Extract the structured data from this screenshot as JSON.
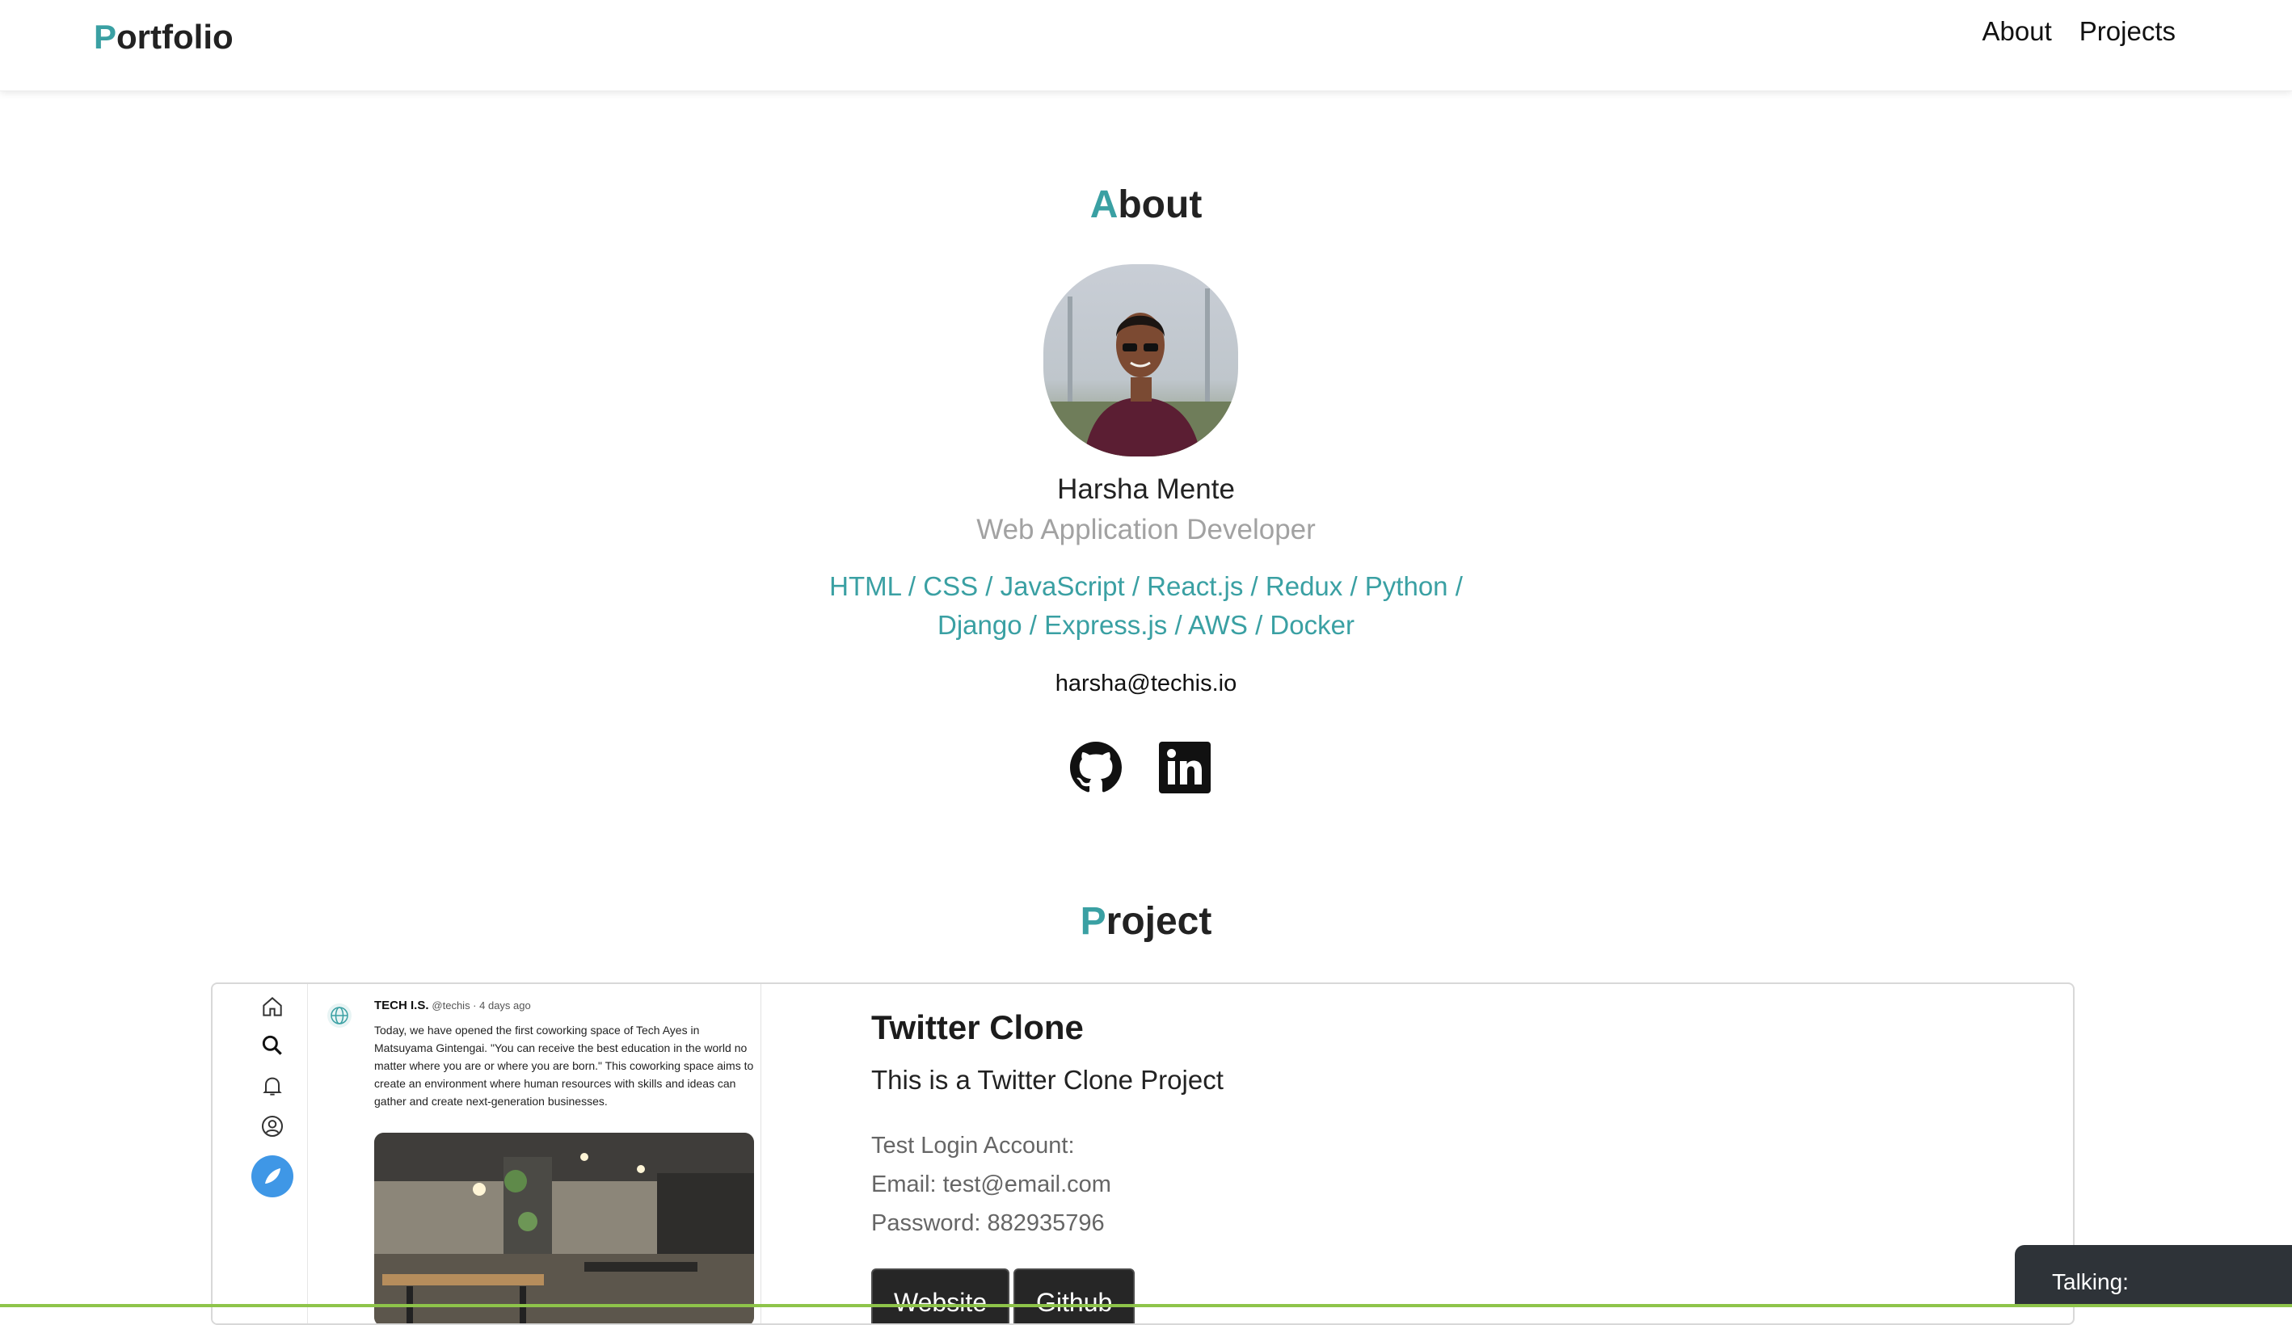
{
  "header": {
    "brand_first": "P",
    "brand_rest": "ortfolio",
    "nav": [
      {
        "label": "About"
      },
      {
        "label": "Projects"
      }
    ]
  },
  "about": {
    "title_first": "A",
    "title_rest": "bout",
    "name": "Harsha Mente",
    "role": "Web Application Developer",
    "skills": "HTML / CSS / JavaScript / React.js / Redux / Python / Django / Express.js / AWS / Docker",
    "email": "harsha@techis.io",
    "socials": [
      {
        "icon": "github-icon"
      },
      {
        "icon": "linkedin-icon"
      }
    ]
  },
  "project_section": {
    "title_first": "P",
    "title_rest": "roject",
    "card": {
      "title": "Twitter Clone",
      "description": "This is a Twitter Clone Project",
      "login_heading": "Test Login Account:",
      "email_line": "Email: test@email.com",
      "password_line": "Password: 882935796",
      "website_label": "Website",
      "github_label": "Github",
      "screenshot": {
        "account": "TECH I.S.",
        "handle": "@techis · 4 days ago",
        "text": "Today, we have opened the first coworking space of Tech Ayes in Matsuyama Gintengai. \"You can receive the best education in the world no matter where you are or where you are born.\" This coworking space aims to create an environment where human resources with skills and ideas can gather and create next-generation businesses."
      }
    }
  },
  "widget": {
    "talking_label": "Talking:"
  },
  "colors": {
    "accent": "#3aa0a3",
    "button_bg": "#262626",
    "widget_bg": "#2e3338",
    "compose_blue": "#3f97e6"
  }
}
